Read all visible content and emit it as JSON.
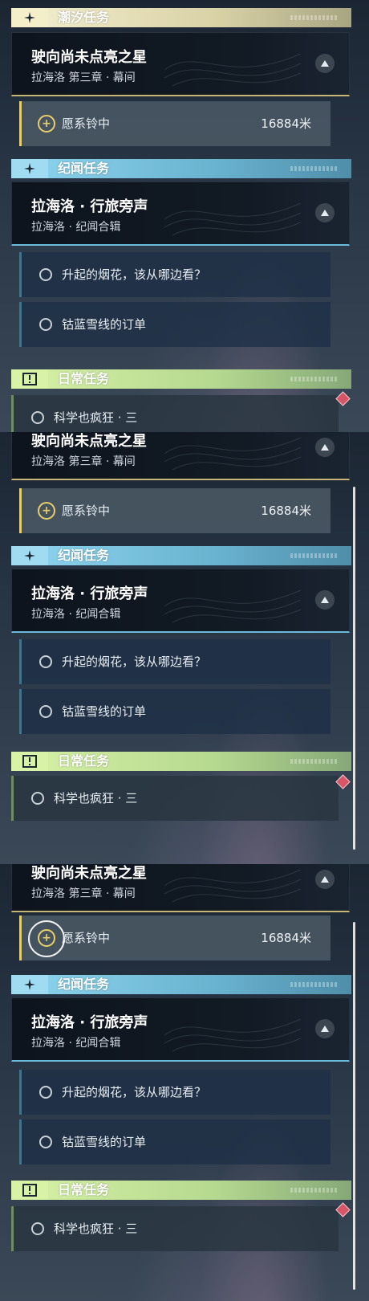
{
  "colors": {
    "main_accent": "#e5cd73",
    "side_accent": "#6cb9dc",
    "daily_accent": "#b5d98f",
    "alert": "#d65566"
  },
  "sections": {
    "main": {
      "title": "潮汐任务",
      "icon": "sparkle-icon"
    },
    "side": {
      "title": "纪闻任务",
      "icon": "sparkle-icon"
    },
    "daily": {
      "title": "日常任务",
      "icon": "exclamation-box-icon"
    }
  },
  "main_quest": {
    "title": "驶向尚未点亮之星",
    "subtitle": "拉海洛 第三章 · 幕间",
    "tracked": {
      "label": "愿系铃中",
      "distance": "16884米",
      "icon": "tracking-target-icon"
    }
  },
  "side_quest": {
    "title": "拉海洛 · 行旅旁声",
    "subtitle": "拉海洛 · 纪闻合辑",
    "objectives": [
      {
        "label": "升起的烟花，该从哪边看？"
      },
      {
        "label": "钴蓝雪线的订单"
      }
    ]
  },
  "daily_quest": {
    "objectives": [
      {
        "label": "科学也疯狂 · 三"
      }
    ]
  },
  "frames": [
    {
      "scrollbar": "hidden",
      "tap_highlight": "none"
    },
    {
      "scrollbar": "visible",
      "tap_highlight": "none"
    },
    {
      "scrollbar": "visible",
      "tap_highlight": "tracking-target-icon"
    }
  ]
}
